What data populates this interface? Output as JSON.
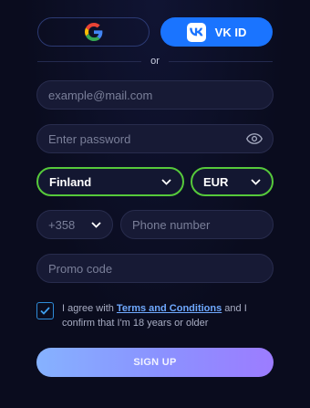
{
  "social": {
    "google_icon": "google-g-logo",
    "vk_icon": "vk-logo",
    "vk_label": "VK ID",
    "vk_color": "#1a74ff"
  },
  "divider": {
    "text": "or"
  },
  "form": {
    "email_placeholder": "example@mail.com",
    "password_placeholder": "Enter password",
    "country": "Finland",
    "currency": "EUR",
    "phone_code": "+358",
    "phone_placeholder": "Phone number",
    "promo_placeholder": "Promo code"
  },
  "agreement": {
    "checked": true,
    "text_before": "I agree with ",
    "link_text": "Terms and Conditions",
    "text_after": " and I confirm that I'm 18 years or older"
  },
  "signup": {
    "label": "SIGN UP"
  },
  "colors": {
    "valid_border": "#56c93b",
    "accent_link": "#6fa9ff",
    "checkbox_border": "#2e8bd8"
  }
}
